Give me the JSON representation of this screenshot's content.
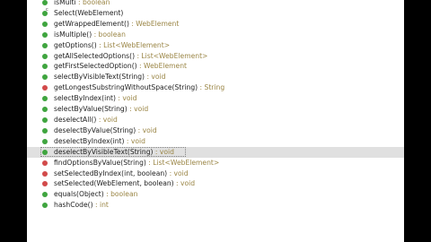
{
  "methods": [
    {
      "name": "isMulti",
      "ret": " : boolean",
      "icon": "field-icon",
      "color": "#3fa53f"
    },
    {
      "name": "Select(WebElement)",
      "ret": "",
      "icon": "constructor-icon",
      "color": "#3fa53f"
    },
    {
      "name": "getWrappedElement()",
      "ret": " : WebElement",
      "icon": "public-method-icon",
      "color": "#3fa53f"
    },
    {
      "name": "isMultiple()",
      "ret": " : boolean",
      "icon": "public-method-icon",
      "color": "#3fa53f"
    },
    {
      "name": "getOptions()",
      "ret": " : List<WebElement>",
      "icon": "public-method-icon",
      "color": "#3fa53f"
    },
    {
      "name": "getAllSelectedOptions()",
      "ret": " : List<WebElement>",
      "icon": "public-method-icon",
      "color": "#3fa53f"
    },
    {
      "name": "getFirstSelectedOption()",
      "ret": " : WebElement",
      "icon": "public-method-icon",
      "color": "#3fa53f"
    },
    {
      "name": "selectByVisibleText(String)",
      "ret": " : void",
      "icon": "public-method-icon",
      "color": "#3fa53f"
    },
    {
      "name": "getLongestSubstringWithoutSpace(String)",
      "ret": " : String",
      "icon": "private-method-icon",
      "color": "#d24a4a"
    },
    {
      "name": "selectByIndex(int)",
      "ret": " : void",
      "icon": "public-method-icon",
      "color": "#3fa53f"
    },
    {
      "name": "selectByValue(String)",
      "ret": " : void",
      "icon": "public-method-icon",
      "color": "#3fa53f"
    },
    {
      "name": "deselectAll()",
      "ret": " : void",
      "icon": "public-method-icon",
      "color": "#3fa53f"
    },
    {
      "name": "deselectByValue(String)",
      "ret": " : void",
      "icon": "public-method-icon",
      "color": "#3fa53f"
    },
    {
      "name": "deselectByIndex(int)",
      "ret": " : void",
      "icon": "public-method-icon",
      "color": "#3fa53f"
    },
    {
      "name": "deselectByVisibleText(String)",
      "ret": " : void",
      "icon": "public-method-icon",
      "color": "#3fa53f",
      "selected": true
    },
    {
      "name": "findOptionsByValue(String)",
      "ret": " : List<WebElement>",
      "icon": "private-method-icon",
      "color": "#d24a4a"
    },
    {
      "name": "setSelectedByIndex(int, boolean)",
      "ret": " : void",
      "icon": "private-method-icon",
      "color": "#d24a4a"
    },
    {
      "name": "setSelected(WebElement, boolean)",
      "ret": " : void",
      "icon": "private-method-icon",
      "color": "#d24a4a"
    },
    {
      "name": "equals(Object)",
      "ret": " : boolean",
      "icon": "public-method-icon",
      "color": "#3fa53f"
    },
    {
      "name": "hashCode()",
      "ret": " : int",
      "icon": "public-method-icon",
      "color": "#3fa53f"
    }
  ]
}
